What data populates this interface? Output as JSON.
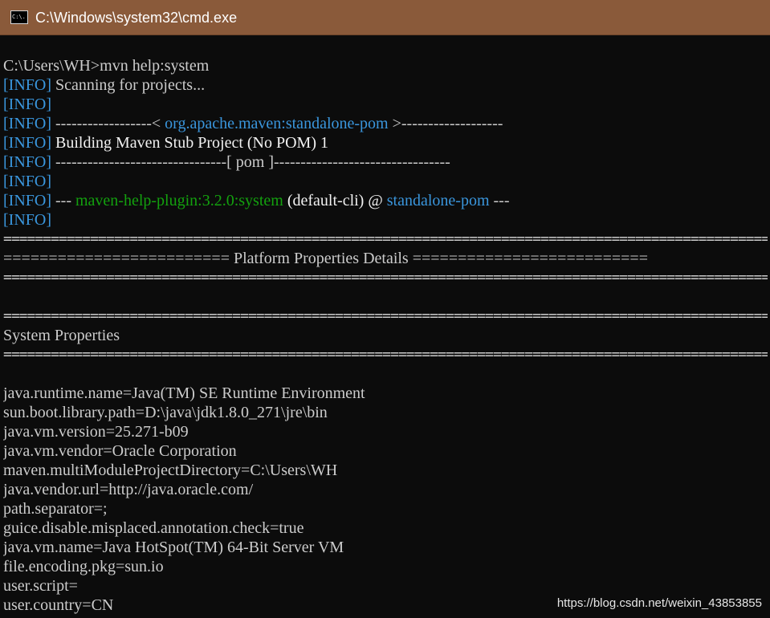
{
  "window": {
    "title": "C:\\Windows\\system32\\cmd.exe",
    "icon_text": "C:\\."
  },
  "console": {
    "prompt_line": "C:\\Users\\WH>mvn help:system",
    "info_tag": "[INFO]",
    "scanning": " Scanning for projects...",
    "artifact_pre": " ------------------< ",
    "artifact_name": "org.apache.maven:standalone-pom",
    "artifact_post": " >-------------------",
    "building": " Building Maven Stub Project (No POM) 1",
    "pom_line": " --------------------------------[ pom ]---------------------------------",
    "plugin_pre": " --- ",
    "plugin_name": "maven-help-plugin:3.2.0:system",
    "plugin_mid": " (default-cli) @ ",
    "plugin_project": "standalone-pom",
    "plugin_post": " ---",
    "separator": "=====================================================================================================",
    "platform_line": "========================= Platform Properties Details ==========================",
    "system_properties": "System Properties",
    "properties": [
      "java.runtime.name=Java(TM) SE Runtime Environment",
      "sun.boot.library.path=D:\\java\\jdk1.8.0_271\\jre\\bin",
      "java.vm.version=25.271-b09",
      "java.vm.vendor=Oracle Corporation",
      "maven.multiModuleProjectDirectory=C:\\Users\\WH",
      "java.vendor.url=http://java.oracle.com/",
      "path.separator=;",
      "guice.disable.misplaced.annotation.check=true",
      "java.vm.name=Java HotSpot(TM) 64-Bit Server VM",
      "file.encoding.pkg=sun.io",
      "user.script=",
      "user.country=CN"
    ]
  },
  "watermark": "https://blog.csdn.net/weixin_43853855",
  "colors": {
    "titlebar": "#8a5a3a",
    "background": "#0c0c0c",
    "text": "#cccccc",
    "info": "#3a96dd",
    "plugin": "#13a10e"
  }
}
